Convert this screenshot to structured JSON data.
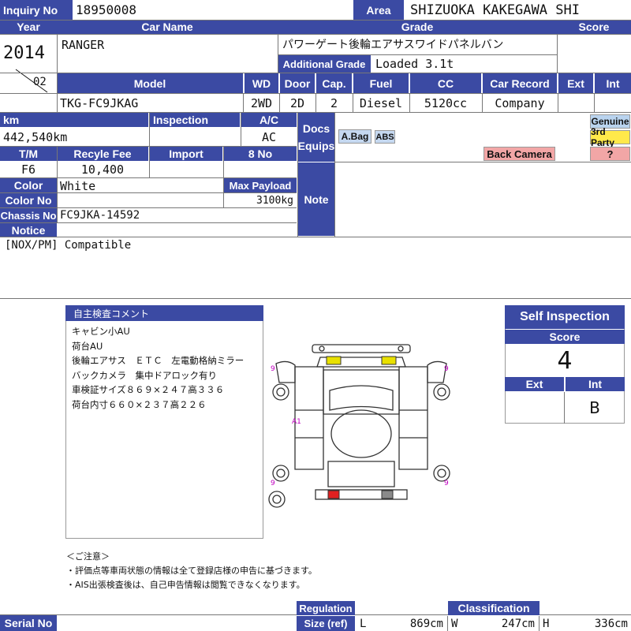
{
  "header": {
    "inquiry_no_label": "Inquiry No",
    "inquiry_no": "18950008",
    "area_label": "Area",
    "area": "SHIZUOKA KAKEGAWA SHI"
  },
  "vehicle": {
    "year_label": "Year",
    "car_name_label": "Car Name",
    "grade_label": "Grade",
    "score_label": "Score",
    "year": "2014",
    "month": "02",
    "car_name": "RANGER",
    "grade": "パワーゲート後輪エアサスワイドパネルバン",
    "additional_grade_label": "Additional Grade",
    "additional_grade": "Loaded 3.1t",
    "model_label": "Model",
    "wd_label": "WD",
    "door_label": "Door",
    "cap_label": "Cap.",
    "fuel_label": "Fuel",
    "cc_label": "CC",
    "car_record_label": "Car Record",
    "ext_label": "Ext",
    "int_label": "Int",
    "model": "TKG-FC9JKAG",
    "wd": "2WD",
    "door": "2D",
    "cap": "2",
    "fuel": "Diesel",
    "cc": "5120cc",
    "car_record": "Company",
    "km_label": "km",
    "inspection_label": "Inspection",
    "ac_label": "A/C",
    "km": "442,540km",
    "ac": "AC",
    "docs_label": "Docs",
    "equips_label": "Equips",
    "tm_label": "T/M",
    "recycle_fee_label": "Recyle Fee",
    "import_label": "Import",
    "eight_no_label": "8 No",
    "tm": "F6",
    "recycle_fee": "10,400",
    "color_label": "Color",
    "color": "White",
    "max_payload_label": "Max Payload",
    "max_payload": "3100kg",
    "color_no_label": "Color No",
    "note_label": "Note",
    "chassis_no_label": "Chassis No",
    "chassis_no": "FC9JKA-14592",
    "notice_label": "Notice",
    "notice": "[NOX/PM] Compatible"
  },
  "equips": {
    "abag": "A.Bag",
    "abs": "ABS",
    "back_camera": "Back Camera",
    "genuine": "Genuine",
    "third_party": "3rd Party",
    "unknown": "?"
  },
  "comments": {
    "title": "自主検査コメント",
    "lines": [
      "キャビン小AU",
      "荷台AU",
      "後輪エアサス　ＥＴＣ　左電動格納ミラー",
      "バックカメラ　集中ドアロック有り",
      "車検証サイズ８６９×２４７高３３６",
      "荷台内寸６６０×２３７高２２６"
    ]
  },
  "diagram": {
    "marks": [
      "9",
      "9",
      "9",
      "9",
      "A1"
    ]
  },
  "self_inspection": {
    "title": "Self Inspection",
    "score_label": "Score",
    "score": "4",
    "ext_label": "Ext",
    "int_label": "Int",
    "ext": "",
    "int": "B"
  },
  "caution": {
    "title": "＜ご注意＞",
    "lines": [
      "・評価点等車両状態の情報は全て登録店様の申告に基づきます。",
      "・AIS出張検査後は、自己申告情報は閲覧できなくなります。"
    ]
  },
  "footer": {
    "serial_no_label": "Serial No",
    "regulation_label": "Regulation",
    "size_ref_label": "Size (ref)",
    "classification_label": "Classification",
    "l_label": "L",
    "l": "869cm",
    "w_label": "W",
    "w": "247cm",
    "h_label": "H",
    "h": "336cm"
  },
  "colors": {
    "header_blue": "#3b4aa3",
    "back_camera_bg": "#f2a6a6",
    "genuine_bg": "#b9d3ee",
    "third_party_bg": "#ffe94a",
    "equip_badge_bg": "#c5d8f0",
    "damage_yellow": "#e8e000",
    "damage_red": "#e02020"
  }
}
